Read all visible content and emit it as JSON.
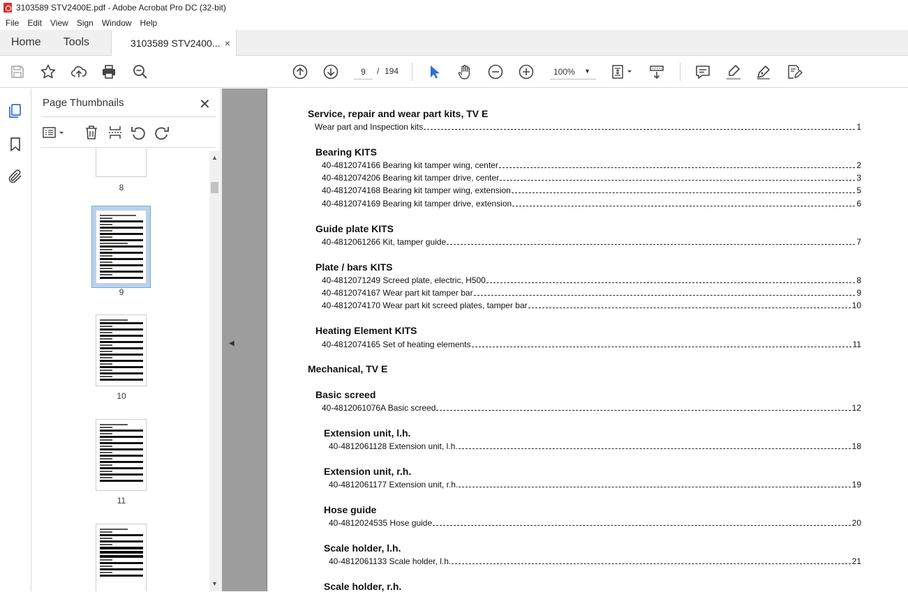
{
  "window": {
    "title": "3103589 STV2400E.pdf - Adobe Acrobat Pro DC (32-bit)"
  },
  "menu": [
    "File",
    "Edit",
    "View",
    "Sign",
    "Window",
    "Help"
  ],
  "tabs": {
    "home": "Home",
    "tools": "Tools",
    "document": "3103589 STV2400...",
    "close": "×"
  },
  "toolbar": {
    "page_current": "9",
    "page_sep": "/",
    "page_total": "194",
    "zoom": "100%"
  },
  "thumbnails": {
    "title": "Page Thumbnails",
    "close": "✕",
    "pages": [
      {
        "label": "8"
      },
      {
        "label": "9",
        "selected": true
      },
      {
        "label": "10"
      },
      {
        "label": "11"
      }
    ]
  },
  "toc": {
    "sec1": "Service, repair and wear part kits, TV E",
    "e1": {
      "t": "Wear part and Inspection kits",
      "n": "1"
    },
    "g_bearing": "Bearing KITS",
    "e2": {
      "t": "40-4812074166 Bearing kit tamper wing, center",
      "n": "2"
    },
    "e3": {
      "t": "40-4812074206 Bearing kit tamper drive, center",
      "n": "3"
    },
    "e4": {
      "t": "40-4812074168 Bearing kit tamper wing, extension",
      "n": "5"
    },
    "e5": {
      "t": "40-4812074169 Bearing kit tamper drive, extension",
      "n": "6"
    },
    "g_guide": "Guide plate KITS",
    "e6": {
      "t": "40-4812061266 Kit, tamper guide",
      "n": "7"
    },
    "g_plate": "Plate / bars KITS",
    "e7": {
      "t": "40-4812071249 Screed plate, electric, H500",
      "n": "8"
    },
    "e8": {
      "t": "40-4812074167 Wear part kit tamper bar",
      "n": "9"
    },
    "e9": {
      "t": "40-4812074170 Wear part kit screed plates, tamper bar",
      "n": "10"
    },
    "g_heat": "Heating Element KITS",
    "e10": {
      "t": "40-4812074165 Set of heating elements",
      "n": "11"
    },
    "sec2": "Mechanical, TV E",
    "g_basic": "Basic screed",
    "e11": {
      "t": "40-4812061076A Basic screed",
      "n": "12"
    },
    "g_extl": "Extension unit, l.h.",
    "e12": {
      "t": "40-4812061128 Extension unit, l.h.",
      "n": "18"
    },
    "g_extr": "Extension unit, r.h.",
    "e13": {
      "t": "40-4812061177 Extension unit, r.h.",
      "n": "19"
    },
    "g_hose": "Hose guide",
    "e14": {
      "t": "40-4812024535 Hose guide",
      "n": "20"
    },
    "g_scalel": "Scale holder, l.h.",
    "e15": {
      "t": "40-4812061133 Scale holder, l.h.",
      "n": "21"
    },
    "g_scaler": "Scale holder, r.h."
  }
}
